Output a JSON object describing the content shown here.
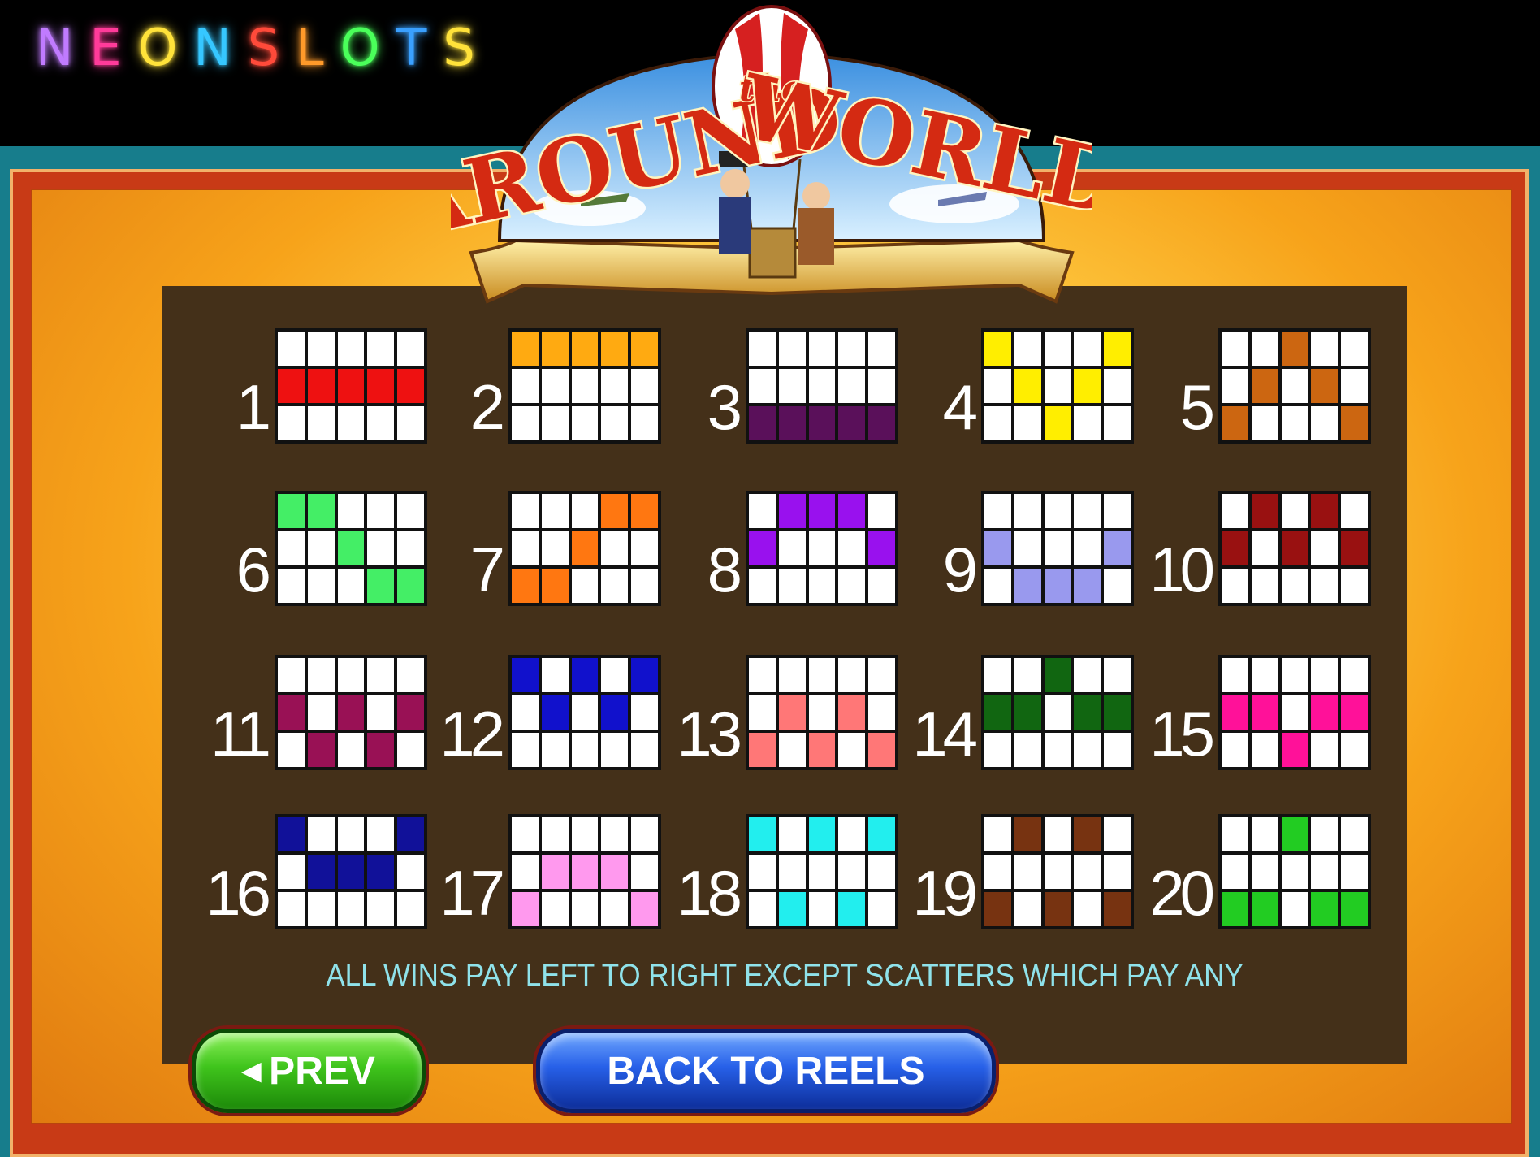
{
  "brand": {
    "letters": [
      {
        "ch": "N",
        "color": "#c07bff"
      },
      {
        "ch": "E",
        "color": "#ff3b9a"
      },
      {
        "ch": "O",
        "color": "#ffe23a"
      },
      {
        "ch": "N",
        "color": "#36c7ff"
      },
      {
        "ch": "S",
        "color": "#ff4a3a"
      },
      {
        "ch": "L",
        "color": "#ff9a2a"
      },
      {
        "ch": "O",
        "color": "#4aff5a"
      },
      {
        "ch": "T",
        "color": "#3aa0ff"
      },
      {
        "ch": "S",
        "color": "#ffe23a"
      }
    ]
  },
  "logo": {
    "word_left": "AROUND",
    "word_mid": "the",
    "word_right": "WORLD"
  },
  "paylines": [
    {
      "n": "1",
      "color": "#ee1111",
      "cells": [
        [
          1,
          0
        ],
        [
          1,
          1
        ],
        [
          1,
          2
        ],
        [
          1,
          3
        ],
        [
          1,
          4
        ]
      ]
    },
    {
      "n": "2",
      "color": "#ffaa11",
      "cells": [
        [
          0,
          0
        ],
        [
          0,
          1
        ],
        [
          0,
          2
        ],
        [
          0,
          3
        ],
        [
          0,
          4
        ]
      ]
    },
    {
      "n": "3",
      "color": "#5a105a",
      "cells": [
        [
          2,
          0
        ],
        [
          2,
          1
        ],
        [
          2,
          2
        ],
        [
          2,
          3
        ],
        [
          2,
          4
        ]
      ]
    },
    {
      "n": "4",
      "color": "#ffee00",
      "cells": [
        [
          0,
          0
        ],
        [
          1,
          1
        ],
        [
          2,
          2
        ],
        [
          1,
          3
        ],
        [
          0,
          4
        ]
      ]
    },
    {
      "n": "5",
      "color": "#cc6611",
      "cells": [
        [
          2,
          0
        ],
        [
          1,
          1
        ],
        [
          0,
          2
        ],
        [
          1,
          3
        ],
        [
          2,
          4
        ]
      ]
    },
    {
      "n": "6",
      "color": "#44ee66",
      "cells": [
        [
          0,
          0
        ],
        [
          0,
          1
        ],
        [
          1,
          2
        ],
        [
          2,
          3
        ],
        [
          2,
          4
        ]
      ]
    },
    {
      "n": "7",
      "color": "#ff7711",
      "cells": [
        [
          2,
          0
        ],
        [
          2,
          1
        ],
        [
          1,
          2
        ],
        [
          0,
          3
        ],
        [
          0,
          4
        ]
      ]
    },
    {
      "n": "8",
      "color": "#9911ee",
      "cells": [
        [
          1,
          0
        ],
        [
          0,
          1
        ],
        [
          0,
          2
        ],
        [
          0,
          3
        ],
        [
          1,
          4
        ]
      ]
    },
    {
      "n": "9",
      "color": "#9999ee",
      "cells": [
        [
          1,
          0
        ],
        [
          2,
          1
        ],
        [
          2,
          2
        ],
        [
          2,
          3
        ],
        [
          1,
          4
        ]
      ]
    },
    {
      "n": "10",
      "color": "#991111",
      "cells": [
        [
          1,
          0
        ],
        [
          0,
          1
        ],
        [
          1,
          2
        ],
        [
          0,
          3
        ],
        [
          1,
          4
        ]
      ]
    },
    {
      "n": "11",
      "color": "#991155",
      "cells": [
        [
          1,
          0
        ],
        [
          2,
          1
        ],
        [
          1,
          2
        ],
        [
          2,
          3
        ],
        [
          1,
          4
        ]
      ]
    },
    {
      "n": "12",
      "color": "#1111cc",
      "cells": [
        [
          0,
          0
        ],
        [
          1,
          1
        ],
        [
          0,
          2
        ],
        [
          1,
          3
        ],
        [
          0,
          4
        ]
      ]
    },
    {
      "n": "13",
      "color": "#ff7777",
      "cells": [
        [
          2,
          0
        ],
        [
          1,
          1
        ],
        [
          2,
          2
        ],
        [
          1,
          3
        ],
        [
          2,
          4
        ]
      ]
    },
    {
      "n": "14",
      "color": "#116611",
      "cells": [
        [
          1,
          0
        ],
        [
          1,
          1
        ],
        [
          0,
          2
        ],
        [
          1,
          3
        ],
        [
          1,
          4
        ]
      ]
    },
    {
      "n": "15",
      "color": "#ff1199",
      "cells": [
        [
          1,
          0
        ],
        [
          1,
          1
        ],
        [
          2,
          2
        ],
        [
          1,
          3
        ],
        [
          1,
          4
        ]
      ]
    },
    {
      "n": "16",
      "color": "#111199",
      "cells": [
        [
          0,
          0
        ],
        [
          1,
          1
        ],
        [
          1,
          2
        ],
        [
          1,
          3
        ],
        [
          0,
          4
        ]
      ]
    },
    {
      "n": "17",
      "color": "#ff99ee",
      "cells": [
        [
          2,
          0
        ],
        [
          1,
          1
        ],
        [
          1,
          2
        ],
        [
          1,
          3
        ],
        [
          2,
          4
        ]
      ]
    },
    {
      "n": "18",
      "color": "#22eeee",
      "cells": [
        [
          0,
          0
        ],
        [
          2,
          1
        ],
        [
          0,
          2
        ],
        [
          2,
          3
        ],
        [
          0,
          4
        ]
      ]
    },
    {
      "n": "19",
      "color": "#773311",
      "cells": [
        [
          2,
          0
        ],
        [
          0,
          1
        ],
        [
          2,
          2
        ],
        [
          0,
          3
        ],
        [
          2,
          4
        ]
      ]
    },
    {
      "n": "20",
      "color": "#22cc22",
      "cells": [
        [
          2,
          0
        ],
        [
          2,
          1
        ],
        [
          0,
          2
        ],
        [
          2,
          3
        ],
        [
          2,
          4
        ]
      ]
    }
  ],
  "rules_text": "ALL WINS PAY LEFT TO RIGHT EXCEPT SCATTERS WHICH PAY ANY",
  "buttons": {
    "prev": "PREV",
    "back": "BACK TO REELS"
  }
}
